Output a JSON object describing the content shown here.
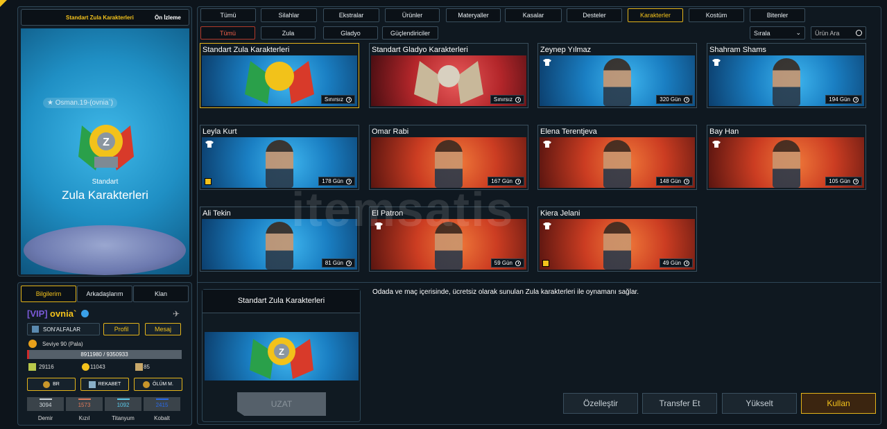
{
  "preview": {
    "tab_active": "Standart Zula Karakterleri",
    "tab_other": "Ön İzleme",
    "user_tag": "★ Osman.19-(ovnia`)",
    "subtitle": "Standart",
    "title": "Zula Karakterleri"
  },
  "profile": {
    "tabs": [
      "Bilgilerim",
      "Arkadaşlarım",
      "Klan"
    ],
    "vip_tag": "[VIP]",
    "username": "ovnia`",
    "clan": "SON'ALFALAR",
    "profile_btn": "Profil",
    "message_btn": "Mesaj",
    "level": "Seviye 90 (Pala)",
    "xp": "8911980 / 9350933",
    "currencies": [
      "29116",
      "11043",
      "85"
    ],
    "modes": [
      "BR",
      "REKABET",
      "ÖLÜM M."
    ],
    "materials": [
      {
        "value": "3094",
        "label": "Demir",
        "color": "#cfd6da"
      },
      {
        "value": "1573",
        "label": "Kızıl",
        "color": "#e07a5a"
      },
      {
        "value": "1092",
        "label": "Titanyum",
        "color": "#5ac8e8"
      },
      {
        "value": "2415",
        "label": "Kobalt",
        "color": "#2a6ae8"
      }
    ],
    "material_labels_shown": [
      "Demir",
      "Kızıl",
      "Titanyum",
      "Kobalt"
    ]
  },
  "categories": [
    "Tümü",
    "Silahlar",
    "Ekstralar",
    "Ürünler",
    "Materyaller",
    "Kasalar",
    "Desteler",
    "Karakterler",
    "Kostüm",
    "Bitenler"
  ],
  "category_selected": "Karakterler",
  "subcategories": [
    "Tümü",
    "Zula",
    "Gladyo",
    "Güçlendiriciler"
  ],
  "sort_label": "Sırala",
  "search_placeholder": "Ürün Ara",
  "items": [
    {
      "name": "Standart Zula Karakterleri",
      "duration": "Sınırsız",
      "theme": "blue",
      "selected": true,
      "tee": false,
      "square": false
    },
    {
      "name": "Standart Gladyo Karakterleri",
      "duration": "Sınırsız",
      "theme": "crimson",
      "selected": false,
      "tee": false,
      "square": false
    },
    {
      "name": "Zeynep Yılmaz",
      "duration": "320 Gün",
      "theme": "blue",
      "selected": false,
      "tee": true,
      "square": false
    },
    {
      "name": "Shahram Shams",
      "duration": "194 Gün",
      "theme": "blue",
      "selected": false,
      "tee": true,
      "square": false
    },
    {
      "name": "Leyla Kurt",
      "duration": "178 Gün",
      "theme": "blue",
      "selected": false,
      "tee": true,
      "square": true
    },
    {
      "name": "Omar Rabi",
      "duration": "167 Gün",
      "theme": "red",
      "selected": false,
      "tee": false,
      "square": false
    },
    {
      "name": "Elena Terentjeva",
      "duration": "148 Gün",
      "theme": "red",
      "selected": false,
      "tee": true,
      "square": false
    },
    {
      "name": "Bay Han",
      "duration": "105 Gün",
      "theme": "red",
      "selected": false,
      "tee": true,
      "square": false
    },
    {
      "name": "Ali Tekin",
      "duration": "81 Gün",
      "theme": "blue",
      "selected": false,
      "tee": false,
      "square": false
    },
    {
      "name": "El Patron",
      "duration": "59 Gün",
      "theme": "red",
      "selected": false,
      "tee": true,
      "square": false
    },
    {
      "name": "Kiera Jelani",
      "duration": "49 Gün",
      "theme": "red",
      "selected": false,
      "tee": true,
      "square": true
    }
  ],
  "detail": {
    "title": "Standart Zula Karakterleri",
    "extend_btn": "UZAT",
    "description": "Odada ve maç içerisinde, ücretsiz olarak sunulan Zula karakterleri ile oynamanı sağlar."
  },
  "actions": [
    "Özelleştir",
    "Transfer Et",
    "Yükselt",
    "Kullan"
  ],
  "watermark": "itemsatis"
}
